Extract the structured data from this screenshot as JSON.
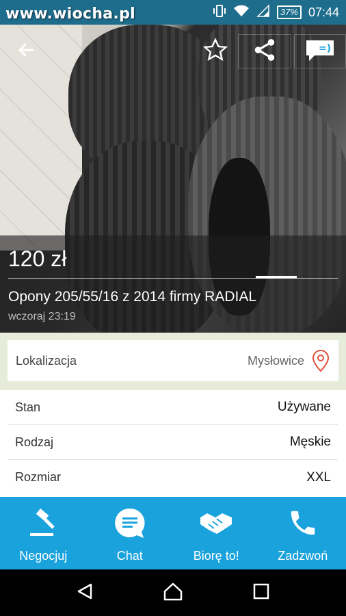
{
  "status_bar": {
    "watermark": "www.wiocha.pl",
    "battery": "37%",
    "time": "07:44"
  },
  "header": {
    "back_icon": "arrow-back-icon",
    "favorite_icon": "star-outline-icon",
    "share_icon": "share-icon",
    "chat_icon": "chat-bubble-icon"
  },
  "listing": {
    "price": "120 zł",
    "title": "Opony 205/55/16 z 2014 firmy RADIAL",
    "posted": "wczoraj 23:19"
  },
  "location": {
    "label": "Lokalizacja",
    "value": "Mysłowice",
    "accent": "#e0533d"
  },
  "details": [
    {
      "label": "Stan",
      "value": "Używane"
    },
    {
      "label": "Rodzaj",
      "value": "Męskie"
    },
    {
      "label": "Rozmiar",
      "value": "XXL"
    }
  ],
  "actions": [
    {
      "label": "Negocjuj",
      "icon": "gavel-icon"
    },
    {
      "label": "Chat",
      "icon": "chat-icon"
    },
    {
      "label": "Biorę to!",
      "icon": "handshake-icon"
    },
    {
      "label": "Zadzwoń",
      "icon": "phone-icon"
    }
  ],
  "colors": {
    "action_bar": "#19a2dc",
    "status_bar": "#1f6d8c"
  }
}
